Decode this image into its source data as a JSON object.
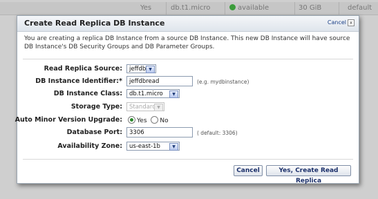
{
  "background_row": {
    "col_yes": "Yes",
    "col_class": "db.t1.micro",
    "col_status": "available",
    "col_storage": "30 GiB",
    "col_default": "default"
  },
  "dialog": {
    "title": "Create Read Replica DB Instance",
    "close_label": "Cancel",
    "close_glyph": "x",
    "intro": "You are creating a replica DB Instance from a source DB Instance. This new DB Instance will have source DB Instance's DB Security Groups and DB Parameter Groups."
  },
  "form": {
    "source": {
      "label": "Read Replica Source:",
      "value": "jeffdb"
    },
    "identifier": {
      "label": "DB Instance Identifier:*",
      "value": "jeffdbread",
      "hint": "(e.g. mydbinstance)"
    },
    "instance_class": {
      "label": "DB Instance Class:",
      "value": "db.t1.micro"
    },
    "storage_type": {
      "label": "Storage Type:",
      "value": "Standard"
    },
    "auto_minor": {
      "label": "Auto Minor Version Upgrade:",
      "yes": "Yes",
      "no": "No",
      "selected": "Yes"
    },
    "port": {
      "label": "Database Port:",
      "value": "3306",
      "hint": "( default: 3306)"
    },
    "zone": {
      "label": "Availability Zone:",
      "value": "us-east-1b"
    }
  },
  "buttons": {
    "cancel": "Cancel",
    "create": "Yes, Create Read Replica"
  },
  "icons": {
    "dropdown": "chevron-down-icon",
    "status": "status-dot-icon"
  },
  "colors": {
    "accent": "#1a2f6a",
    "status_green": "#3a9c3a"
  }
}
